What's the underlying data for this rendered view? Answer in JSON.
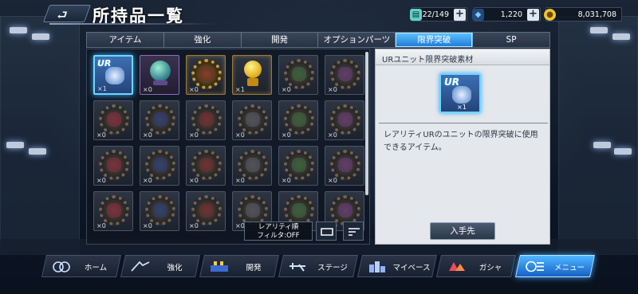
{
  "header": {
    "title": "所持品一覧",
    "back_label": "⮐"
  },
  "resources": [
    {
      "name": "capacity",
      "value": "22/149",
      "icon": "storage-icon",
      "color": "#5fd3c8"
    },
    {
      "name": "gems",
      "value": "1,220",
      "icon": "gem-icon",
      "color": "#7ec8ff"
    },
    {
      "name": "gold",
      "value": "8,031,708",
      "icon": "coin-icon",
      "color": "#f2c230"
    }
  ],
  "tabs": [
    {
      "label": "アイテム",
      "active": false
    },
    {
      "label": "強化",
      "active": false
    },
    {
      "label": "開発",
      "active": false
    },
    {
      "label": "オプションパーツ",
      "active": false
    },
    {
      "label": "限界突破",
      "active": true
    },
    {
      "label": "SP",
      "active": false
    }
  ],
  "items": [
    {
      "type": "ur",
      "qty": "×1",
      "style": "selected"
    },
    {
      "type": "orb",
      "qty": "×0",
      "style": "purple"
    },
    {
      "type": "gear",
      "qty": "×0",
      "style": "gold"
    },
    {
      "type": "trophy",
      "qty": "×1",
      "style": "gold"
    },
    {
      "type": "gear",
      "qty": "×0",
      "style": "plain"
    },
    {
      "type": "gear",
      "qty": "×0",
      "style": "plain"
    },
    {
      "type": "gear",
      "qty": "×0",
      "style": "plain"
    },
    {
      "type": "gear",
      "qty": "×0",
      "style": "plain"
    },
    {
      "type": "gear",
      "qty": "×0",
      "style": "plain"
    },
    {
      "type": "gear",
      "qty": "×0",
      "style": "plain"
    },
    {
      "type": "gear",
      "qty": "×0",
      "style": "plain"
    },
    {
      "type": "gear",
      "qty": "×0",
      "style": "plain"
    },
    {
      "type": "gear",
      "qty": "×0",
      "style": "plain"
    },
    {
      "type": "gear",
      "qty": "×0",
      "style": "plain"
    },
    {
      "type": "gear",
      "qty": "×0",
      "style": "plain"
    },
    {
      "type": "gear",
      "qty": "×0",
      "style": "plain"
    },
    {
      "type": "gear",
      "qty": "×0",
      "style": "plain"
    },
    {
      "type": "gear",
      "qty": "×0",
      "style": "plain"
    },
    {
      "type": "gear",
      "qty": "×0",
      "style": "plain"
    },
    {
      "type": "gear",
      "qty": "×0",
      "style": "plain"
    },
    {
      "type": "gear",
      "qty": "×0",
      "style": "plain"
    },
    {
      "type": "gear",
      "qty": "×0",
      "style": "plain"
    },
    {
      "type": "gear",
      "qty": "×0",
      "style": "plain"
    },
    {
      "type": "gear",
      "qty": "×0",
      "style": "plain"
    }
  ],
  "sort": {
    "line1": "レアリティ順",
    "line2": "フィルタ:OFF"
  },
  "detail": {
    "title": "URユニット限界突破素材",
    "item_label": "UR",
    "item_qty": "×1",
    "description": "レアリティURのユニットの限界突破に使用できるアイテム。",
    "get_button": "入手先"
  },
  "nav": [
    {
      "label": "ホーム",
      "icon": "home-icon",
      "active": false
    },
    {
      "label": "強化",
      "icon": "enhance-icon",
      "active": false
    },
    {
      "label": "開発",
      "icon": "develop-icon",
      "active": false
    },
    {
      "label": "ステージ",
      "icon": "stage-icon",
      "active": false
    },
    {
      "label": "マイベース",
      "icon": "base-icon",
      "active": false
    },
    {
      "label": "ガシャ",
      "icon": "gacha-icon",
      "active": false
    },
    {
      "label": "メニュー",
      "icon": "menu-icon",
      "active": true
    }
  ]
}
